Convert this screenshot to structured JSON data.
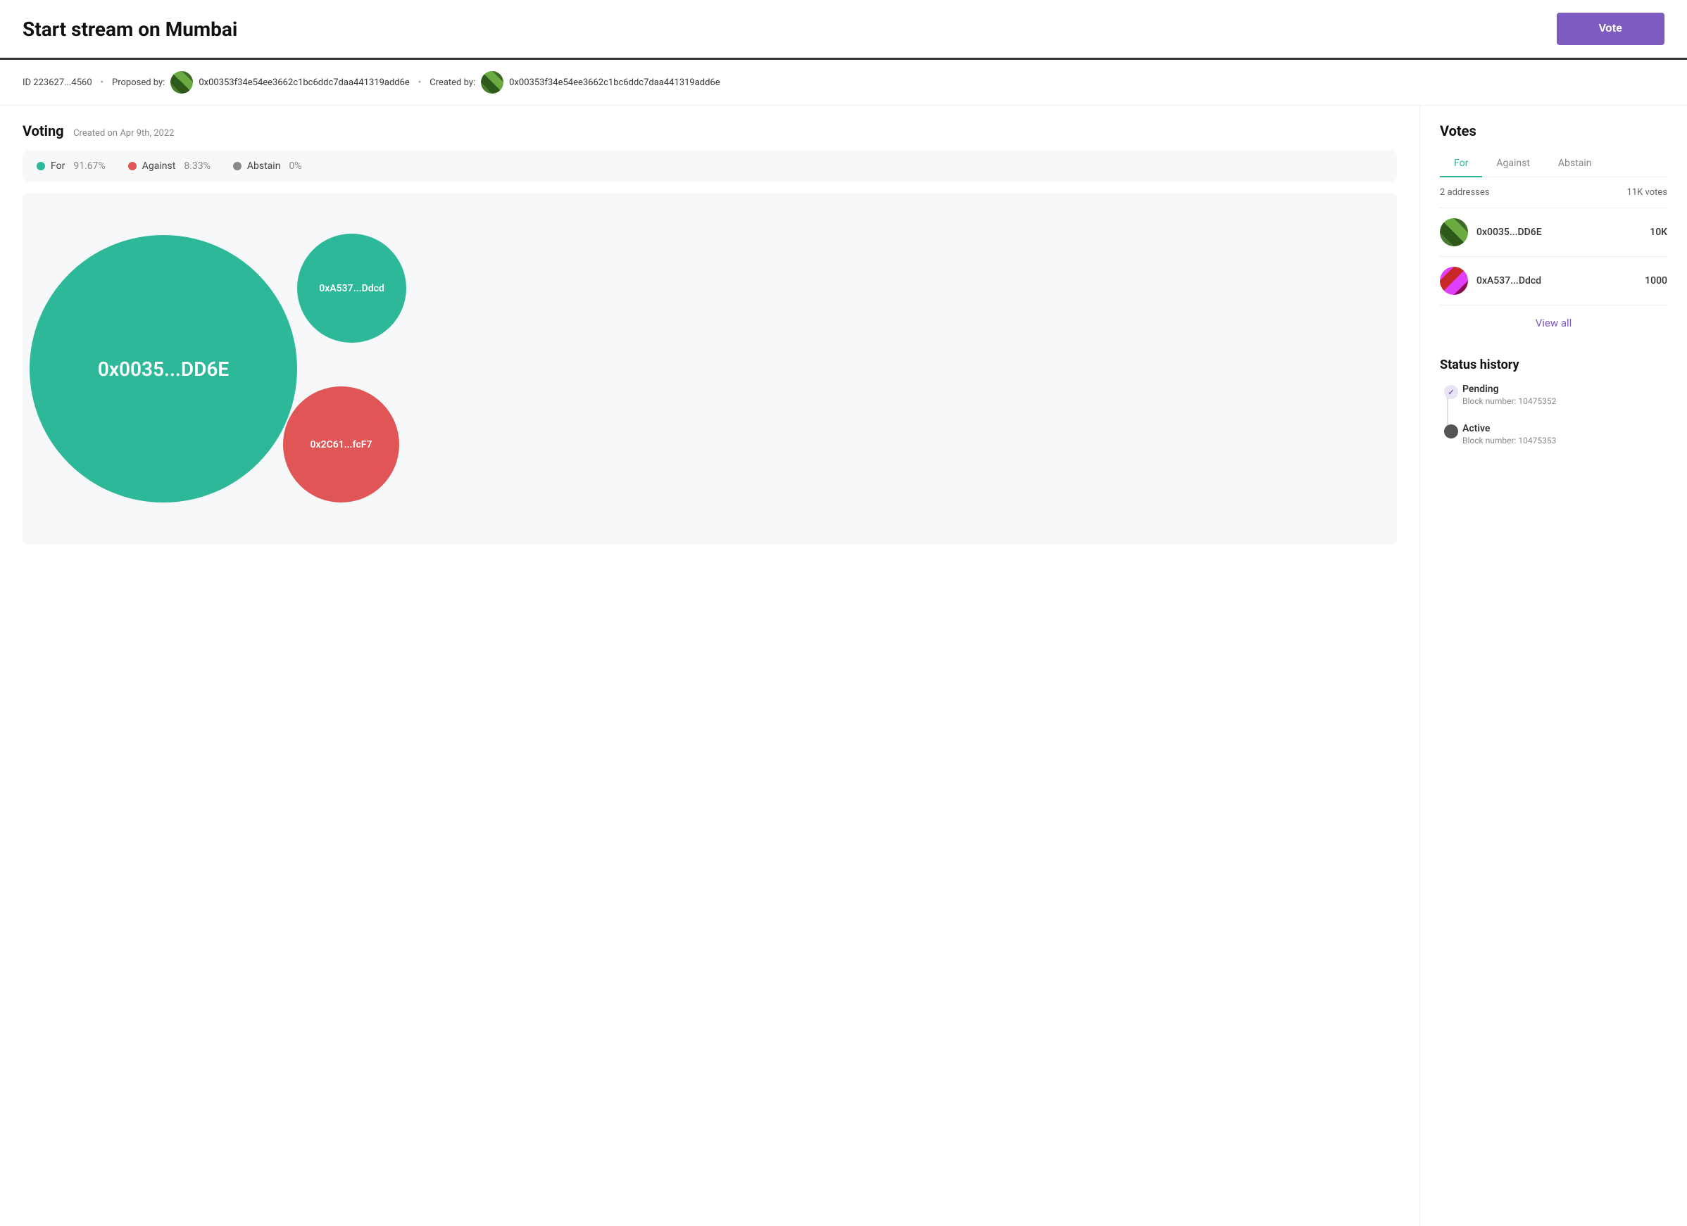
{
  "header": {
    "title": "Start stream on Mumbai",
    "vote_button_label": "Vote"
  },
  "meta": {
    "id_label": "ID 223627...4560",
    "proposed_by_label": "Proposed by:",
    "created_by_label": "Created by:",
    "proposer_address": "0x00353f34e54ee3662c1bc6ddc7daa441319add6e",
    "creator_address": "0x00353f34e54ee3662c1bc6ddc7daa441319add6e",
    "dot_separator": "•"
  },
  "voting": {
    "section_title": "Voting",
    "created_label": "Created on Apr 9th, 2022",
    "for_label": "For",
    "for_pct": "91.67%",
    "against_label": "Against",
    "against_pct": "8.33%",
    "abstain_label": "Abstain",
    "abstain_pct": "0%",
    "colors": {
      "for": "#2db89a",
      "against": "#e05555",
      "abstain": "#888"
    }
  },
  "bubbles": [
    {
      "id": "bubble-for-large",
      "label": "0x0035...DD6E",
      "color": "#2db89a",
      "size": 380,
      "x": 10,
      "y": 60,
      "font_size": "28px"
    },
    {
      "id": "bubble-for-small",
      "label": "0xA537...Ddcd",
      "color": "#2db89a",
      "size": 160,
      "x": 60,
      "y": 58,
      "font_size": "15px"
    },
    {
      "id": "bubble-against",
      "label": "0x2C61...fcF7",
      "color": "#e05555",
      "size": 170,
      "x": 57,
      "y": 72,
      "font_size": "15px"
    }
  ],
  "votes": {
    "section_title": "Votes",
    "tabs": [
      "For",
      "Against",
      "Abstain"
    ],
    "active_tab": "For",
    "addresses_count": "2 addresses",
    "total_votes": "11K votes",
    "voters": [
      {
        "address": "0x0035...DD6E",
        "votes": "10K",
        "avatar_type": "green"
      },
      {
        "address": "0xA537...Ddcd",
        "votes": "1000",
        "avatar_type": "pink"
      }
    ],
    "view_all_label": "View all"
  },
  "status_history": {
    "section_title": "Status history",
    "items": [
      {
        "label": "Pending",
        "sub": "Block number: 10475352",
        "state": "completed"
      },
      {
        "label": "Active",
        "sub": "Block number: 10475353",
        "state": "active"
      }
    ]
  }
}
